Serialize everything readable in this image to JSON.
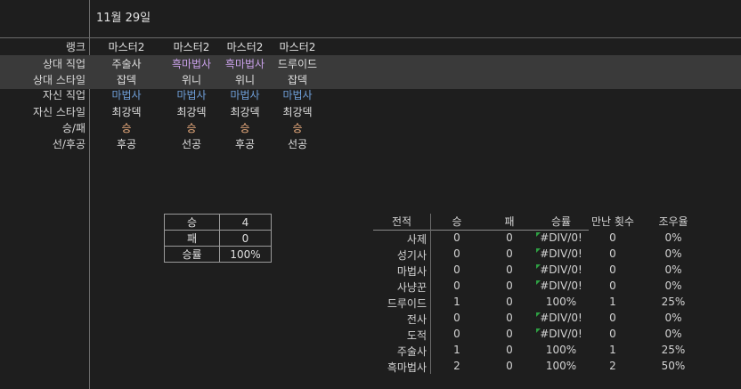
{
  "date": "11월 29일",
  "row_labels": [
    "랭크",
    "상대 직업",
    "상대 스타일",
    "자신 직업",
    "자신 스타일",
    "승/패",
    "선/후공"
  ],
  "games": [
    {
      "rank": "마스터2",
      "opp_class": "주술사",
      "opp_style": "잡덱",
      "my_class": "마법사",
      "my_style": "최강덱",
      "result": "승",
      "turn": "후공"
    },
    {
      "rank": "마스터2",
      "opp_class": "흑마법사",
      "opp_style": "위니",
      "my_class": "마법사",
      "my_style": "최강덱",
      "result": "승",
      "turn": "선공"
    },
    {
      "rank": "마스터2",
      "opp_class": "흑마법사",
      "opp_style": "위니",
      "my_class": "마법사",
      "my_style": "최강덱",
      "result": "승",
      "turn": "후공"
    },
    {
      "rank": "마스터2",
      "opp_class": "드루이드",
      "opp_style": "잡덱",
      "my_class": "마법사",
      "my_style": "최강덱",
      "result": "승",
      "turn": "선공"
    }
  ],
  "summary": {
    "win_label": "승",
    "win_value": "4",
    "loss_label": "패",
    "loss_value": "0",
    "rate_label": "승률",
    "rate_value": "100%"
  },
  "record": {
    "headers": [
      "전적",
      "승",
      "패",
      "승률",
      "만난 횟수",
      "조우율"
    ],
    "rows": [
      {
        "cls": "사제",
        "w": "0",
        "l": "0",
        "rate": "#DIV/0!",
        "met": "0",
        "enc": "0%"
      },
      {
        "cls": "성기사",
        "w": "0",
        "l": "0",
        "rate": "#DIV/0!",
        "met": "0",
        "enc": "0%"
      },
      {
        "cls": "마법사",
        "w": "0",
        "l": "0",
        "rate": "#DIV/0!",
        "met": "0",
        "enc": "0%"
      },
      {
        "cls": "사냥꾼",
        "w": "0",
        "l": "0",
        "rate": "#DIV/0!",
        "met": "0",
        "enc": "0%"
      },
      {
        "cls": "드루이드",
        "w": "1",
        "l": "0",
        "rate": "100%",
        "met": "1",
        "enc": "25%"
      },
      {
        "cls": "전사",
        "w": "0",
        "l": "0",
        "rate": "#DIV/0!",
        "met": "0",
        "enc": "0%"
      },
      {
        "cls": "도적",
        "w": "0",
        "l": "0",
        "rate": "#DIV/0!",
        "met": "0",
        "enc": "0%"
      },
      {
        "cls": "주술사",
        "w": "1",
        "l": "0",
        "rate": "100%",
        "met": "1",
        "enc": "25%"
      },
      {
        "cls": "흑마법사",
        "w": "2",
        "l": "0",
        "rate": "100%",
        "met": "2",
        "enc": "50%"
      }
    ]
  },
  "colors": {
    "background": "#1e1e1e",
    "highlight_row": "#3a3a3a",
    "opp_class": "#c8a0e8",
    "my_class": "#6f9fd8",
    "win": "#f0b080",
    "error_marker": "#2ea043"
  }
}
